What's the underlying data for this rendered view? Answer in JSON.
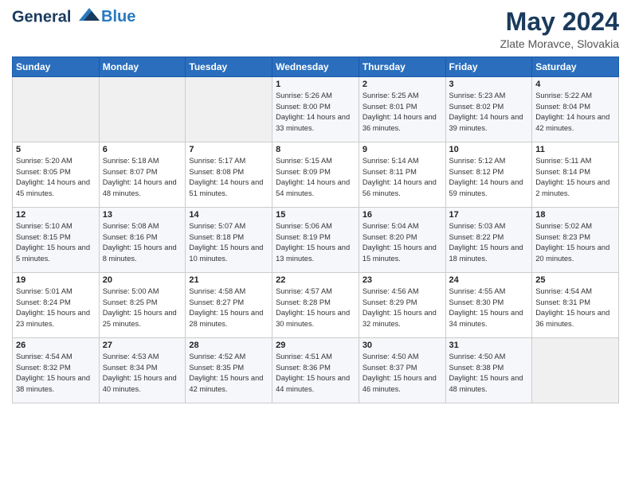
{
  "header": {
    "logo_line1": "General",
    "logo_line2": "Blue",
    "month": "May 2024",
    "location": "Zlate Moravce, Slovakia"
  },
  "weekdays": [
    "Sunday",
    "Monday",
    "Tuesday",
    "Wednesday",
    "Thursday",
    "Friday",
    "Saturday"
  ],
  "weeks": [
    [
      {
        "day": "",
        "info": ""
      },
      {
        "day": "",
        "info": ""
      },
      {
        "day": "",
        "info": ""
      },
      {
        "day": "1",
        "info": "Sunrise: 5:26 AM\nSunset: 8:00 PM\nDaylight: 14 hours\nand 33 minutes."
      },
      {
        "day": "2",
        "info": "Sunrise: 5:25 AM\nSunset: 8:01 PM\nDaylight: 14 hours\nand 36 minutes."
      },
      {
        "day": "3",
        "info": "Sunrise: 5:23 AM\nSunset: 8:02 PM\nDaylight: 14 hours\nand 39 minutes."
      },
      {
        "day": "4",
        "info": "Sunrise: 5:22 AM\nSunset: 8:04 PM\nDaylight: 14 hours\nand 42 minutes."
      }
    ],
    [
      {
        "day": "5",
        "info": "Sunrise: 5:20 AM\nSunset: 8:05 PM\nDaylight: 14 hours\nand 45 minutes."
      },
      {
        "day": "6",
        "info": "Sunrise: 5:18 AM\nSunset: 8:07 PM\nDaylight: 14 hours\nand 48 minutes."
      },
      {
        "day": "7",
        "info": "Sunrise: 5:17 AM\nSunset: 8:08 PM\nDaylight: 14 hours\nand 51 minutes."
      },
      {
        "day": "8",
        "info": "Sunrise: 5:15 AM\nSunset: 8:09 PM\nDaylight: 14 hours\nand 54 minutes."
      },
      {
        "day": "9",
        "info": "Sunrise: 5:14 AM\nSunset: 8:11 PM\nDaylight: 14 hours\nand 56 minutes."
      },
      {
        "day": "10",
        "info": "Sunrise: 5:12 AM\nSunset: 8:12 PM\nDaylight: 14 hours\nand 59 minutes."
      },
      {
        "day": "11",
        "info": "Sunrise: 5:11 AM\nSunset: 8:14 PM\nDaylight: 15 hours\nand 2 minutes."
      }
    ],
    [
      {
        "day": "12",
        "info": "Sunrise: 5:10 AM\nSunset: 8:15 PM\nDaylight: 15 hours\nand 5 minutes."
      },
      {
        "day": "13",
        "info": "Sunrise: 5:08 AM\nSunset: 8:16 PM\nDaylight: 15 hours\nand 8 minutes."
      },
      {
        "day": "14",
        "info": "Sunrise: 5:07 AM\nSunset: 8:18 PM\nDaylight: 15 hours\nand 10 minutes."
      },
      {
        "day": "15",
        "info": "Sunrise: 5:06 AM\nSunset: 8:19 PM\nDaylight: 15 hours\nand 13 minutes."
      },
      {
        "day": "16",
        "info": "Sunrise: 5:04 AM\nSunset: 8:20 PM\nDaylight: 15 hours\nand 15 minutes."
      },
      {
        "day": "17",
        "info": "Sunrise: 5:03 AM\nSunset: 8:22 PM\nDaylight: 15 hours\nand 18 minutes."
      },
      {
        "day": "18",
        "info": "Sunrise: 5:02 AM\nSunset: 8:23 PM\nDaylight: 15 hours\nand 20 minutes."
      }
    ],
    [
      {
        "day": "19",
        "info": "Sunrise: 5:01 AM\nSunset: 8:24 PM\nDaylight: 15 hours\nand 23 minutes."
      },
      {
        "day": "20",
        "info": "Sunrise: 5:00 AM\nSunset: 8:25 PM\nDaylight: 15 hours\nand 25 minutes."
      },
      {
        "day": "21",
        "info": "Sunrise: 4:58 AM\nSunset: 8:27 PM\nDaylight: 15 hours\nand 28 minutes."
      },
      {
        "day": "22",
        "info": "Sunrise: 4:57 AM\nSunset: 8:28 PM\nDaylight: 15 hours\nand 30 minutes."
      },
      {
        "day": "23",
        "info": "Sunrise: 4:56 AM\nSunset: 8:29 PM\nDaylight: 15 hours\nand 32 minutes."
      },
      {
        "day": "24",
        "info": "Sunrise: 4:55 AM\nSunset: 8:30 PM\nDaylight: 15 hours\nand 34 minutes."
      },
      {
        "day": "25",
        "info": "Sunrise: 4:54 AM\nSunset: 8:31 PM\nDaylight: 15 hours\nand 36 minutes."
      }
    ],
    [
      {
        "day": "26",
        "info": "Sunrise: 4:54 AM\nSunset: 8:32 PM\nDaylight: 15 hours\nand 38 minutes."
      },
      {
        "day": "27",
        "info": "Sunrise: 4:53 AM\nSunset: 8:34 PM\nDaylight: 15 hours\nand 40 minutes."
      },
      {
        "day": "28",
        "info": "Sunrise: 4:52 AM\nSunset: 8:35 PM\nDaylight: 15 hours\nand 42 minutes."
      },
      {
        "day": "29",
        "info": "Sunrise: 4:51 AM\nSunset: 8:36 PM\nDaylight: 15 hours\nand 44 minutes."
      },
      {
        "day": "30",
        "info": "Sunrise: 4:50 AM\nSunset: 8:37 PM\nDaylight: 15 hours\nand 46 minutes."
      },
      {
        "day": "31",
        "info": "Sunrise: 4:50 AM\nSunset: 8:38 PM\nDaylight: 15 hours\nand 48 minutes."
      },
      {
        "day": "",
        "info": ""
      }
    ]
  ]
}
